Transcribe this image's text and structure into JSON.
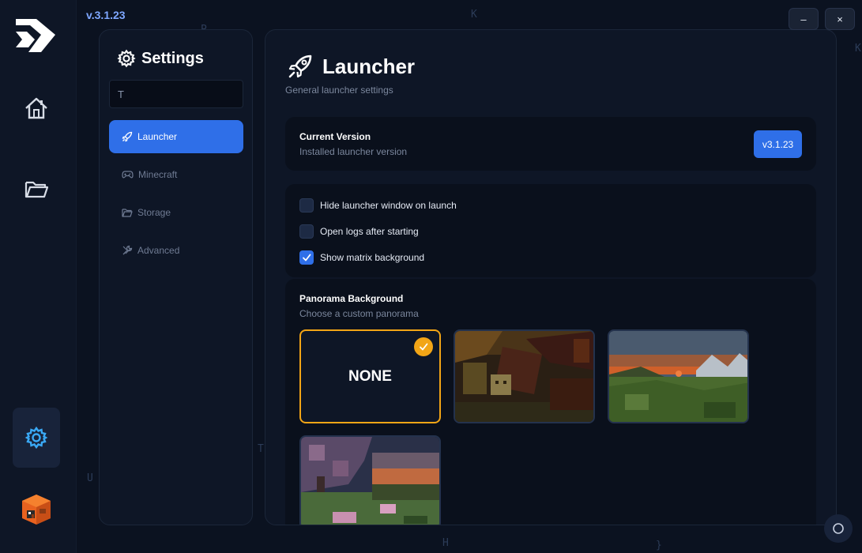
{
  "app": {
    "version_label": "v.3.1.23"
  },
  "rail": {
    "items": [
      {
        "icon": "home-icon"
      },
      {
        "icon": "folder-icon"
      },
      {
        "icon": "gear-icon"
      }
    ],
    "active_item": "gear-icon"
  },
  "window": {
    "minimize_label": "–",
    "close_label": "×"
  },
  "settings_nav": {
    "title": "Settings",
    "search_value": "T",
    "items": [
      {
        "label": "Launcher",
        "icon": "rocket-icon"
      },
      {
        "label": "Minecraft",
        "icon": "gamepad-icon"
      },
      {
        "label": "Storage",
        "icon": "folder-icon"
      },
      {
        "label": "Advanced",
        "icon": "wrench-icon"
      }
    ],
    "active_item": "Launcher"
  },
  "page": {
    "title": "Launcher",
    "subtitle": "General launcher settings"
  },
  "current_version": {
    "label": "Current Version",
    "description": "Installed launcher version",
    "badge": "v3.1.23"
  },
  "options": [
    {
      "label": "Hide launcher window on launch",
      "checked": false
    },
    {
      "label": "Open logs after starting",
      "checked": false
    },
    {
      "label": "Show matrix background",
      "checked": true
    }
  ],
  "panorama": {
    "label": "Panorama Background",
    "description": "Choose a custom panorama",
    "none_label": "NONE",
    "selected": "NONE"
  },
  "colors": {
    "accent": "#2f6fe8",
    "selected": "#f2a516",
    "background": "#0b1220",
    "panel": "#0e1626"
  }
}
